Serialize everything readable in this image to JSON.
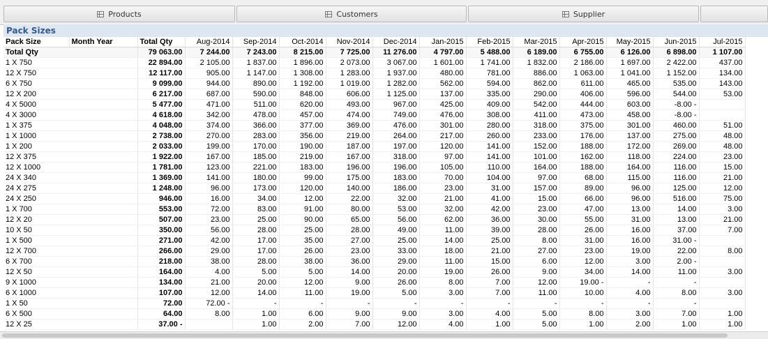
{
  "tabs": [
    "Products",
    "Customers",
    "Supplier"
  ],
  "panel_title": "Pack Sizes",
  "headers": {
    "pack_size": "Pack Size",
    "month_year": "Month Year",
    "total_qty": "Total Qty",
    "months": [
      "Aug-2014",
      "Sep-2014",
      "Oct-2014",
      "Nov-2014",
      "Dec-2014",
      "Jan-2015",
      "Feb-2015",
      "Mar-2015",
      "Apr-2015",
      "May-2015",
      "Jun-2015",
      "Jul-2015"
    ]
  },
  "total_row": {
    "label": "Total Qty",
    "total": "79 063.00",
    "values": [
      "7 244.00",
      "7 243.00",
      "8 215.00",
      "7 725.00",
      "11 276.00",
      "4 797.00",
      "5 488.00",
      "6 189.00",
      "6 755.00",
      "6 126.00",
      "6 898.00",
      "1 107.00"
    ]
  },
  "rows": [
    {
      "label": "1 X 750",
      "total": "22 894.00",
      "values": [
        "2 105.00",
        "1 837.00",
        "1 896.00",
        "2 073.00",
        "3 067.00",
        "1 601.00",
        "1 741.00",
        "1 832.00",
        "2 186.00",
        "1 697.00",
        "2 422.00",
        "437.00"
      ]
    },
    {
      "label": "12 X 750",
      "total": "12 117.00",
      "values": [
        "905.00",
        "1 147.00",
        "1 308.00",
        "1 283.00",
        "1 937.00",
        "480.00",
        "781.00",
        "886.00",
        "1 063.00",
        "1 041.00",
        "1 152.00",
        "134.00"
      ]
    },
    {
      "label": "6 X 750",
      "total": "9 099.00",
      "values": [
        "944.00",
        "890.00",
        "1 192.00",
        "1 019.00",
        "1 282.00",
        "562.00",
        "594.00",
        "862.00",
        "611.00",
        "465.00",
        "535.00",
        "143.00"
      ]
    },
    {
      "label": "12 X 200",
      "total": "6 217.00",
      "values": [
        "687.00",
        "590.00",
        "848.00",
        "606.00",
        "1 125.00",
        "137.00",
        "335.00",
        "290.00",
        "406.00",
        "596.00",
        "544.00",
        "53.00"
      ]
    },
    {
      "label": "4 X 5000",
      "total": "5 477.00",
      "values": [
        "471.00",
        "511.00",
        "620.00",
        "493.00",
        "967.00",
        "425.00",
        "409.00",
        "542.00",
        "444.00",
        "603.00",
        "-8.00 -",
        ""
      ]
    },
    {
      "label": "4 X 3000",
      "total": "4 618.00",
      "values": [
        "342.00",
        "478.00",
        "457.00",
        "474.00",
        "749.00",
        "476.00",
        "308.00",
        "411.00",
        "473.00",
        "458.00",
        "-8.00 -",
        ""
      ]
    },
    {
      "label": "1 X 375",
      "total": "4 048.00",
      "values": [
        "374.00",
        "366.00",
        "377.00",
        "369.00",
        "476.00",
        "301.00",
        "280.00",
        "318.00",
        "375.00",
        "301.00",
        "460.00",
        "51.00"
      ]
    },
    {
      "label": "1 X 1000",
      "total": "2 738.00",
      "values": [
        "270.00",
        "283.00",
        "356.00",
        "219.00",
        "264.00",
        "217.00",
        "260.00",
        "233.00",
        "176.00",
        "137.00",
        "275.00",
        "48.00"
      ]
    },
    {
      "label": "1 X 200",
      "total": "2 033.00",
      "values": [
        "199.00",
        "170.00",
        "190.00",
        "187.00",
        "197.00",
        "120.00",
        "141.00",
        "152.00",
        "188.00",
        "172.00",
        "269.00",
        "48.00"
      ]
    },
    {
      "label": "12 X 375",
      "total": "1 922.00",
      "values": [
        "167.00",
        "185.00",
        "219.00",
        "167.00",
        "318.00",
        "97.00",
        "141.00",
        "101.00",
        "162.00",
        "118.00",
        "224.00",
        "23.00"
      ]
    },
    {
      "label": "12 X 1000",
      "total": "1 781.00",
      "values": [
        "123.00",
        "221.00",
        "183.00",
        "196.00",
        "196.00",
        "105.00",
        "110.00",
        "164.00",
        "188.00",
        "164.00",
        "116.00",
        "15.00"
      ]
    },
    {
      "label": "24 X 340",
      "total": "1 369.00",
      "values": [
        "141.00",
        "180.00",
        "99.00",
        "175.00",
        "183.00",
        "70.00",
        "104.00",
        "97.00",
        "68.00",
        "115.00",
        "116.00",
        "21.00"
      ]
    },
    {
      "label": "24 X 275",
      "total": "1 248.00",
      "values": [
        "96.00",
        "173.00",
        "120.00",
        "140.00",
        "186.00",
        "23.00",
        "31.00",
        "157.00",
        "89.00",
        "96.00",
        "125.00",
        "12.00"
      ]
    },
    {
      "label": "24 X 250",
      "total": "946.00",
      "values": [
        "16.00",
        "34.00",
        "12.00",
        "22.00",
        "32.00",
        "21.00",
        "41.00",
        "15.00",
        "66.00",
        "96.00",
        "516.00",
        "75.00"
      ]
    },
    {
      "label": "1 X 700",
      "total": "553.00",
      "values": [
        "72.00",
        "83.00",
        "91.00",
        "80.00",
        "53.00",
        "32.00",
        "42.00",
        "23.00",
        "47.00",
        "13.00",
        "14.00",
        "3.00"
      ]
    },
    {
      "label": "12 X 20",
      "total": "507.00",
      "values": [
        "23.00",
        "25.00",
        "90.00",
        "65.00",
        "56.00",
        "62.00",
        "36.00",
        "30.00",
        "55.00",
        "31.00",
        "13.00",
        "21.00"
      ]
    },
    {
      "label": "10 X 50",
      "total": "350.00",
      "values": [
        "56.00",
        "28.00",
        "25.00",
        "28.00",
        "49.00",
        "11.00",
        "39.00",
        "28.00",
        "26.00",
        "16.00",
        "37.00",
        "7.00"
      ]
    },
    {
      "label": "1 X 500",
      "total": "271.00",
      "values": [
        "42.00",
        "17.00",
        "35.00",
        "27.00",
        "25.00",
        "14.00",
        "25.00",
        "8.00",
        "31.00",
        "16.00",
        "31.00 -",
        ""
      ]
    },
    {
      "label": "12 X 700",
      "total": "266.00",
      "values": [
        "29.00",
        "17.00",
        "26.00",
        "23.00",
        "33.00",
        "18.00",
        "21.00",
        "27.00",
        "23.00",
        "19.00",
        "22.00",
        "8.00"
      ]
    },
    {
      "label": "6 X 700",
      "total": "218.00",
      "values": [
        "38.00",
        "28.00",
        "38.00",
        "36.00",
        "29.00",
        "11.00",
        "15.00",
        "6.00",
        "12.00",
        "3.00",
        "2.00 -",
        ""
      ]
    },
    {
      "label": "12 X 50",
      "total": "164.00",
      "values": [
        "4.00",
        "5.00",
        "5.00",
        "14.00",
        "20.00",
        "19.00",
        "26.00",
        "9.00",
        "34.00",
        "14.00",
        "11.00",
        "3.00"
      ]
    },
    {
      "label": "9 X 1000",
      "total": "134.00",
      "values": [
        "21.00",
        "20.00",
        "12.00",
        "9.00",
        "26.00",
        "8.00",
        "7.00",
        "12.00",
        "19.00 -",
        "-",
        "-",
        ""
      ]
    },
    {
      "label": "6 X 1000",
      "total": "107.00",
      "values": [
        "12.00",
        "14.00",
        "11.00",
        "19.00",
        "5.00",
        "3.00",
        "7.00",
        "11.00",
        "10.00",
        "4.00",
        "8.00",
        "3.00"
      ]
    },
    {
      "label": "1 X 50",
      "total": "72.00",
      "values": [
        "72.00 -",
        "-",
        "-",
        "-",
        "-",
        "-",
        "-",
        "-",
        "-",
        "-",
        "-",
        ""
      ]
    },
    {
      "label": "6 X 500",
      "total": "64.00",
      "values": [
        "8.00",
        "1.00",
        "6.00",
        "9.00",
        "9.00",
        "3.00",
        "4.00",
        "5.00",
        "8.00",
        "3.00",
        "7.00",
        "1.00"
      ]
    },
    {
      "label": "12 X 25",
      "total": "37.00 -",
      "values": [
        "",
        "1.00",
        "2.00",
        "7.00",
        "12.00",
        "4.00",
        "1.00",
        "5.00",
        "1.00",
        "2.00",
        "1.00",
        "1.00"
      ]
    }
  ]
}
